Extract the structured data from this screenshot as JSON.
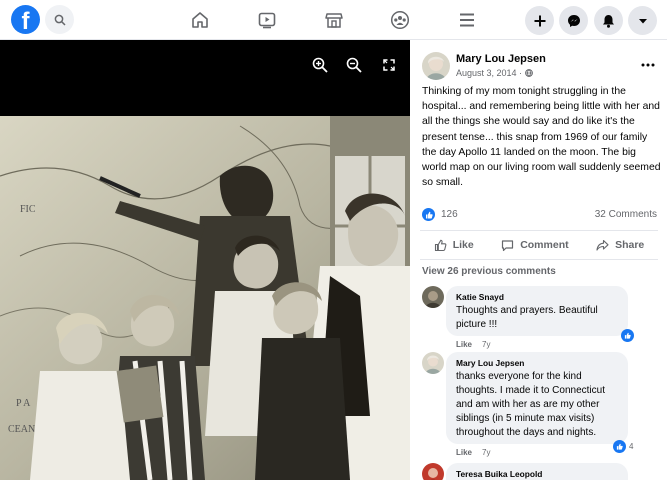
{
  "topbar": {
    "logo_letter": "f",
    "icons": [
      "search-icon",
      "home-icon",
      "watch-icon",
      "marketplace-icon",
      "groups-icon",
      "menu-icon",
      "create-icon",
      "messenger-icon",
      "notifications-icon",
      "account-dropdown-icon"
    ]
  },
  "post": {
    "author": "Mary Lou Jepsen",
    "date": "August 3, 2014 · ",
    "text": "Thinking of my mom tonight struggling in the hospital... and remembering being little with her and all the things she would say and do like it's the present tense... this snap from 1969 of our family the day Apollo 11 landed on the moon. The big world map on our living room wall suddenly seemed so small.",
    "like_count": "126",
    "comment_count": "32 Comments",
    "like_label": "Like",
    "comment_label": "Comment",
    "share_label": "Share",
    "view_previous": "View 26 previous comments"
  },
  "comments": [
    {
      "name": "Katie Snayd",
      "text": "Thoughts and prayers. Beautiful picture !!!",
      "like": "Like",
      "time": "7y",
      "reactions": ""
    },
    {
      "name": "Mary Lou Jepsen",
      "text": "thanks everyone for the kind thoughts. I made it to Connecticut and am with her as are my other siblings (in 5 minute max visits) throughout the days and nights.",
      "like": "Like",
      "time": "7y",
      "reactions": "4"
    },
    {
      "name": "Teresa Buika Leopold",
      "text": "",
      "like": "",
      "time": "",
      "reactions": ""
    }
  ],
  "colors": {
    "brand": "#1877f2",
    "secondary_text": "#65676b",
    "bubble": "#f0f2f5"
  }
}
